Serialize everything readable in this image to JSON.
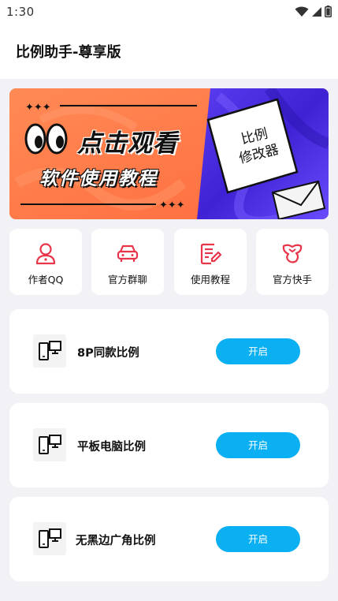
{
  "status_bar": {
    "time": "1:30",
    "icons": [
      "wifi-icon",
      "signal-icon",
      "battery-icon"
    ]
  },
  "app": {
    "title": "比例助手-尊享版"
  },
  "banner": {
    "headline": "点击观看",
    "subline": "软件使用教程",
    "card_line1": "比例",
    "card_line2": "修改器",
    "colors": {
      "orange": "#ff7a45",
      "purple": "#4b2ee0",
      "ink": "#111111"
    }
  },
  "quick_actions": [
    {
      "label": "作者QQ",
      "icon": "person-icon"
    },
    {
      "label": "官方群聊",
      "icon": "car-icon"
    },
    {
      "label": "使用教程",
      "icon": "document-edit-icon"
    },
    {
      "label": "官方快手",
      "icon": "kuaishou-icon"
    }
  ],
  "ratio_items": [
    {
      "label": "8P同款比例",
      "button": "开启",
      "icon": "devices-icon"
    },
    {
      "label": "平板电脑比例",
      "button": "开启",
      "icon": "devices-icon"
    },
    {
      "label": "无黑边广角比例",
      "button": "开启",
      "icon": "devices-icon"
    }
  ],
  "colors": {
    "accent_red": "#e8354a",
    "button_blue": "#0ab0f2",
    "background": "#f2f2f6"
  }
}
